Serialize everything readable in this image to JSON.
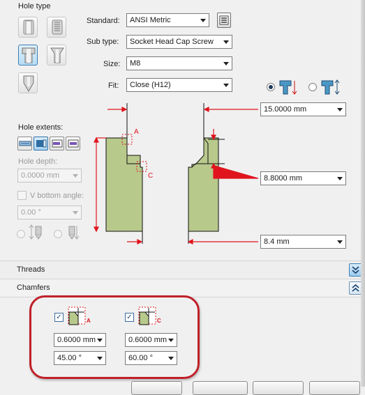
{
  "hole_type": {
    "title": "Hole type"
  },
  "form": {
    "standard_label": "Standard:",
    "standard_value": "ANSI Metric",
    "subtype_label": "Sub type:",
    "subtype_value": "Socket Head Cap Screw",
    "size_label": "Size:",
    "size_value": "M8",
    "fit_label": "Fit:",
    "fit_value": "Close (H12)"
  },
  "hole_extents": {
    "title": "Hole extents:",
    "depth_label": "Hole depth:",
    "depth_value": "0.0000 mm",
    "v_bottom_label": "V bottom angle:",
    "v_bottom_value": "0.00 °"
  },
  "diagram": {
    "label_a": "A",
    "label_c": "C",
    "dim_top": "15.0000 mm",
    "dim_mid": "8.8000 mm",
    "dim_bottom": "8.4 mm"
  },
  "sections": {
    "threads": "Threads",
    "chamfers": "Chamfers"
  },
  "chamfers": {
    "a_icon_label": "A",
    "c_icon_label": "C",
    "a_distance": "0.6000 mm",
    "a_angle": "45.00 °",
    "c_distance": "0.6000 mm",
    "c_angle": "60.00 °"
  },
  "colors": {
    "hole_fill": "#b8c98c",
    "dimension_red": "#e0141d",
    "highlight_ring": "#c0202a"
  }
}
